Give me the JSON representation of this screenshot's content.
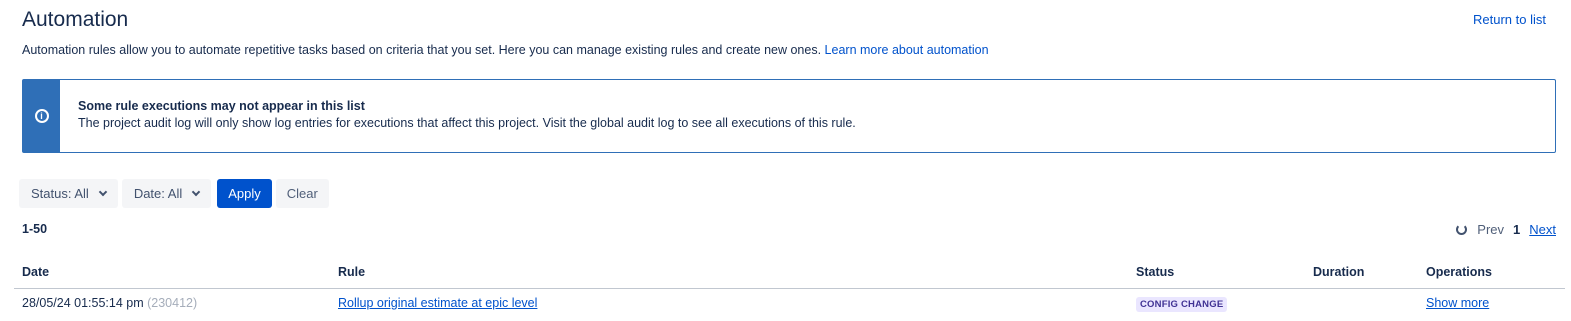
{
  "header": {
    "title": "Automation",
    "return_link": "Return to list",
    "intro_text": "Automation rules allow you to automate repetitive tasks based on criteria that you set. Here you can manage existing rules and create new ones.",
    "intro_link": "Learn more about automation"
  },
  "notice": {
    "icon": "info-icon",
    "heading": "Some rule executions may not appear in this list",
    "body": "The project audit log will only show log entries for executions that affect this project. Visit the global audit log to see all executions of this rule.",
    "accent_color": "#2f6fb7"
  },
  "filters": {
    "status_label": "Status: All",
    "date_label": "Date: All",
    "apply_label": "Apply",
    "clear_label": "Clear"
  },
  "results": {
    "range": "1-50",
    "pager": {
      "refresh_icon": "refresh-icon",
      "prev_label": "Prev",
      "current_page": "1",
      "next_label": "Next"
    }
  },
  "table": {
    "columns": [
      "Date",
      "Rule",
      "Status",
      "Duration",
      "Operations"
    ],
    "rows": [
      {
        "date": "28/05/24 01:55:14 pm",
        "id": "(230412)",
        "rule": "Rollup original estimate at epic level",
        "status": "CONFIG CHANGE",
        "duration": "",
        "operation": "Show more"
      }
    ]
  },
  "colors": {
    "link": "#0052cc",
    "primary_button": "#0052cc",
    "status_lozenge_bg": "#eae6ff",
    "status_lozenge_text": "#403294"
  }
}
